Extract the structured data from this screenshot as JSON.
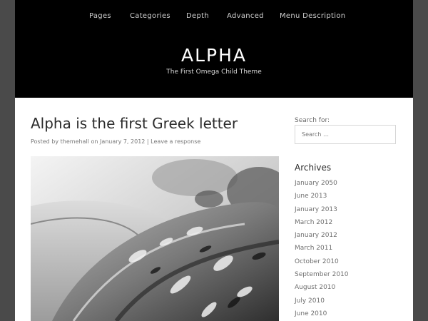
{
  "nav": {
    "items": [
      "Pages",
      "Categories",
      "Depth",
      "Advanced",
      "Menu Description"
    ]
  },
  "site": {
    "title": "ALPHA",
    "tagline": "The First Omega Child Theme"
  },
  "post": {
    "title": "Alpha is the first Greek letter",
    "meta_prefix": "Posted by",
    "author": "themehall",
    "meta_on": "on",
    "date": "January 7, 2012",
    "separator": "|",
    "comment_link": "Leave a response"
  },
  "sidebar": {
    "search": {
      "label": "Search for:",
      "placeholder": "Search …"
    },
    "archives": {
      "title": "Archives",
      "items": [
        "January 2050",
        "June 2013",
        "January 2013",
        "March 2012",
        "January 2012",
        "March 2011",
        "October 2010",
        "September 2010",
        "August 2010",
        "July 2010",
        "June 2010"
      ]
    }
  },
  "colors": {
    "header_bg": "#000000",
    "outer_bg": "#4a4a4a",
    "content_bg": "#ffffff"
  },
  "icons": {
    "post_image": "greyscale-photo"
  }
}
